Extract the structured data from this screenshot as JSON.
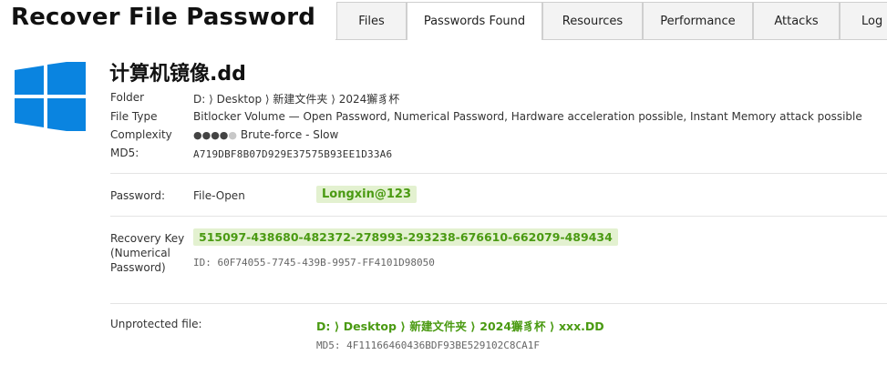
{
  "app": {
    "title": "Recover File Password"
  },
  "tabs": [
    {
      "label": "Files",
      "active": false
    },
    {
      "label": "Passwords Found",
      "active": true
    },
    {
      "label": "Resources",
      "active": false
    },
    {
      "label": "Performance",
      "active": false
    },
    {
      "label": "Attacks",
      "active": false
    },
    {
      "label": "Log",
      "active": false
    }
  ],
  "file": {
    "name": "计算机镜像.dd",
    "icon": "windows-logo-icon",
    "brand_color": "#0a84e0",
    "folder_label": "Folder",
    "folder_value": "D: ⟩ Desktop ⟩ 新建文件夹 ⟩ 2024獬豸杯",
    "type_label": "File Type",
    "type_value": "Bitlocker Volume — Open Password, Numerical Password, Hardware acceleration possible, Instant Memory attack possible",
    "complexity_label": "Complexity",
    "complexity_dots_filled": 4,
    "complexity_dots_total": 5,
    "complexity_value": "Brute-force - Slow",
    "md5_label": "MD5:",
    "md5_value": "A719DBF8B07D929E37575B93EE1D33A6"
  },
  "password": {
    "label": "Password:",
    "kind": "File-Open",
    "value": "Longxin@123",
    "highlight_color": "#e3f1d0",
    "text_color": "#4a9a12"
  },
  "recovery": {
    "label_line1": "Recovery Key",
    "label_line2": "(Numerical",
    "label_line3": "Password)",
    "value": "515097-438680-482372-278993-293238-676610-662079-489434",
    "id_text": "ID: 60F74055-7745-439B-9957-FF4101D98050"
  },
  "unprotected": {
    "label": "Unprotected file:",
    "path": "D: ⟩ Desktop ⟩ 新建文件夹 ⟩ 2024獬豸杯 ⟩ xxx.DD",
    "md5_text": "MD5: 4F11166460436BDF93BE529102C8CA1F"
  }
}
